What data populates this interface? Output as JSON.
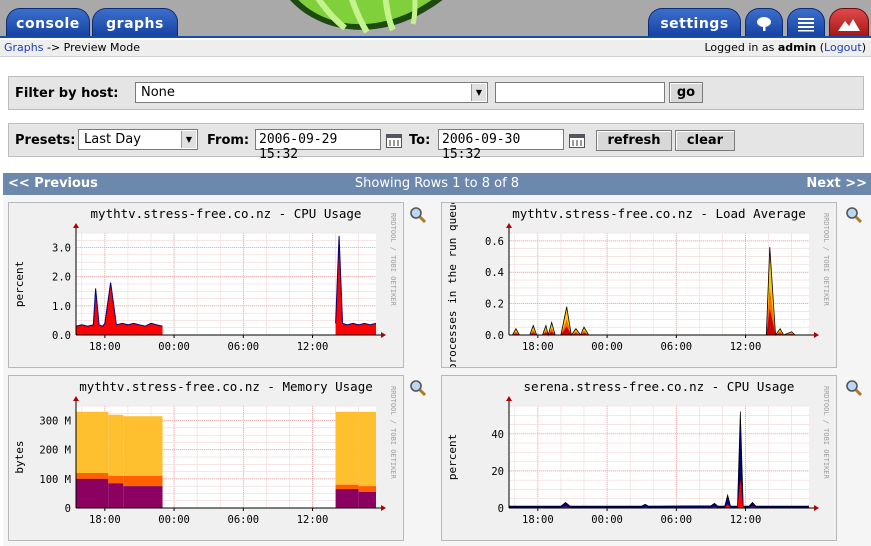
{
  "nav_tabs": {
    "console": "console",
    "graphs": "graphs",
    "settings": "settings"
  },
  "breadcrumb": {
    "link": "Graphs",
    "separator": "->",
    "current": "Preview Mode"
  },
  "login": {
    "prefix": "Logged in as",
    "user": "admin",
    "logout": "Logout"
  },
  "host_filter": {
    "label": "Filter by host:",
    "selected": "None",
    "text_value": "",
    "go_label": "go"
  },
  "presets": {
    "label": "Presets:",
    "selected": "Last Day",
    "from_label": "From:",
    "from_value": "2006-09-29 15:32",
    "to_label": "To:",
    "to_value": "2006-09-30 15:32",
    "refresh_label": "refresh",
    "clear_label": "clear"
  },
  "pager": {
    "previous": "<< Previous",
    "status": "Showing Rows 1 to 8 of 8",
    "next": "Next >>"
  },
  "watermark": "RRDTOOL / TOBI OETIKER",
  "colors": {
    "tab_blue": "#1e4fb0",
    "nav_bar": "#6c88ad",
    "cpu_red": "#ff0000",
    "cpu_navy": "#00007a",
    "mem_yellow": "#ffc030",
    "mem_orange": "#ff6000",
    "mem_purple": "#8c0060"
  },
  "graphs": [
    {
      "title": "mythtv.stress-free.co.nz - CPU Usage",
      "ylabel": "percent",
      "yticks": [
        "0.0",
        "1.0",
        "2.0",
        "3.0"
      ],
      "xticks": [
        "18:00",
        "00:00",
        "06:00",
        "12:00"
      ]
    },
    {
      "title": "mythtv.stress-free.co.nz - Load Average",
      "ylabel": "processes in the run queue",
      "yticks": [
        "0.0",
        "0.2",
        "0.4",
        "0.6"
      ],
      "xticks": [
        "18:00",
        "00:00",
        "06:00",
        "12:00"
      ]
    },
    {
      "title": "mythtv.stress-free.co.nz - Memory Usage",
      "ylabel": "bytes",
      "yticks": [
        "0",
        "100 M",
        "200 M",
        "300 M"
      ],
      "xticks": [
        "18:00",
        "00:00",
        "06:00",
        "12:00"
      ]
    },
    {
      "title": "serena.stress-free.co.nz - CPU Usage",
      "ylabel": "percent",
      "yticks": [
        "0",
        "20",
        "40"
      ],
      "xticks": [
        "18:00",
        "00:00",
        "06:00",
        "12:00"
      ]
    }
  ],
  "chart_data": [
    {
      "type": "area",
      "title": "mythtv.stress-free.co.nz - CPU Usage",
      "ylabel": "percent",
      "x_ticks": [
        "18:00",
        "00:00",
        "06:00",
        "12:00"
      ],
      "ylim": [
        0,
        3.5
      ],
      "grid": true,
      "series": [
        {
          "name": "",
          "segments": [
            {
              "x": [
                15.5,
                16,
                16.5,
                17,
                17.2,
                17.5,
                17.8,
                18,
                18.5,
                19,
                19.5,
                20,
                20.5,
                21,
                21.5,
                22,
                22.5,
                23
              ],
              "values": [
                0.3,
                0.35,
                0.3,
                0.35,
                1.6,
                0.35,
                0.3,
                0.4,
                1.8,
                0.35,
                0.4,
                0.35,
                0.4,
                0.35,
                0.3,
                0.4,
                0.35,
                0.3
              ]
            },
            {
              "x": [
                38,
                38.3,
                38.6,
                39,
                39.5,
                40,
                40.5,
                41,
                41.5
              ],
              "values": [
                0.4,
                3.4,
                0.4,
                0.35,
                0.4,
                0.35,
                0.4,
                0.35,
                0.4
              ]
            }
          ]
        }
      ]
    },
    {
      "type": "area",
      "title": "mythtv.stress-free.co.nz - Load Average",
      "ylabel": "processes in the run queue",
      "x_ticks": [
        "18:00",
        "00:00",
        "06:00",
        "12:00"
      ],
      "ylim": [
        0,
        0.65
      ],
      "grid": true,
      "series": [
        {
          "name": "",
          "points": [
            [
              15.8,
              0.0
            ],
            [
              16.1,
              0.04
            ],
            [
              16.4,
              0.0
            ],
            [
              17.3,
              0.0
            ],
            [
              17.6,
              0.06
            ],
            [
              17.9,
              0.0
            ],
            [
              18.4,
              0.0
            ],
            [
              18.7,
              0.06
            ],
            [
              18.9,
              0.0
            ],
            [
              19.2,
              0.08
            ],
            [
              19.5,
              0.0
            ],
            [
              20.0,
              0.0
            ],
            [
              20.5,
              0.18
            ],
            [
              20.9,
              0.0
            ],
            [
              21.3,
              0.04
            ],
            [
              21.7,
              0.0
            ],
            [
              22.0,
              0.05
            ],
            [
              22.4,
              0.0
            ],
            [
              37.8,
              0.0
            ],
            [
              38.1,
              0.56
            ],
            [
              38.6,
              0.0
            ],
            [
              39.0,
              0.04
            ],
            [
              39.3,
              0.0
            ],
            [
              40.0,
              0.02
            ],
            [
              40.3,
              0.0
            ]
          ]
        }
      ]
    },
    {
      "type": "area",
      "title": "mythtv.stress-free.co.nz - Memory Usage",
      "ylabel": "bytes",
      "x_ticks": [
        "18:00",
        "00:00",
        "06:00",
        "12:00"
      ],
      "ylim": [
        0,
        350
      ],
      "units": "M",
      "grid": true,
      "segments": [
        {
          "x_start": 15.5,
          "x_end": 23,
          "steps": [
            [
              15.5,
              18.3
            ],
            [
              18.3,
              19.6
            ],
            [
              19.6,
              23
            ]
          ],
          "purple": [
            100,
            85,
            75
          ],
          "orange": [
            120,
            110,
            110
          ],
          "yellow": [
            330,
            320,
            315
          ]
        },
        {
          "x_start": 38,
          "x_end": 41.5,
          "steps": [
            [
              38,
              40
            ],
            [
              40,
              41.5
            ]
          ],
          "purple": [
            65,
            55
          ],
          "orange": [
            80,
            75
          ],
          "yellow": [
            330,
            330
          ]
        }
      ]
    },
    {
      "type": "area",
      "title": "serena.stress-free.co.nz - CPU Usage",
      "ylabel": "percent",
      "x_ticks": [
        "18:00",
        "00:00",
        "06:00",
        "12:00"
      ],
      "ylim": [
        0,
        55
      ],
      "grid": true,
      "series": [
        {
          "name": "",
          "points": [
            [
              15.5,
              1
            ],
            [
              20,
              1
            ],
            [
              20.4,
              3
            ],
            [
              20.8,
              1
            ],
            [
              27,
              1
            ],
            [
              27.3,
              2
            ],
            [
              27.6,
              1
            ],
            [
              33,
              1.2
            ],
            [
              33.3,
              2.5
            ],
            [
              33.6,
              1
            ],
            [
              34.2,
              1
            ],
            [
              34.45,
              7
            ],
            [
              34.7,
              1
            ],
            [
              35.3,
              1
            ],
            [
              35.55,
              52
            ],
            [
              35.8,
              1
            ],
            [
              36.3,
              1
            ],
            [
              36.6,
              3
            ],
            [
              36.9,
              1
            ],
            [
              41.5,
              1
            ]
          ]
        }
      ]
    }
  ]
}
